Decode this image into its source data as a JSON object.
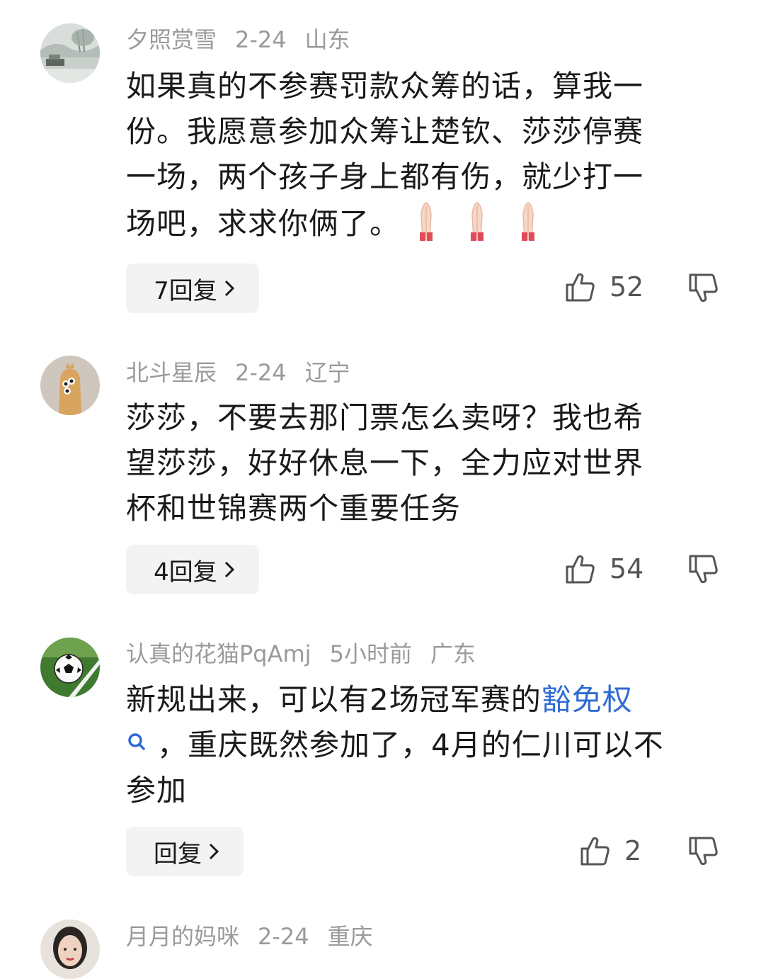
{
  "comments": [
    {
      "user": "夕照赏雪",
      "time": "2-24",
      "location": "山东",
      "lines": [
        "如果真的不参赛罚款众筹的话，算我一",
        "份。我愿意参加众筹让楚钦、莎莎停赛",
        "一场，两个孩子身上都有伤，就少打一",
        "场吧，求求你俩了。"
      ],
      "emoji": "folded-hands",
      "reply_label": "7回复",
      "likes": "52",
      "avatar_icon": "landscape-avatar"
    },
    {
      "user": "北斗星辰",
      "time": "2-24",
      "location": "辽宁",
      "lines": [
        "莎莎，不要去那门票怎么卖呀？我也希",
        "望莎莎，好好休息一下，全力应对世界",
        "杯和世锦赛两个重要任务"
      ],
      "reply_label": "4回复",
      "likes": "54",
      "avatar_icon": "cartoon-avatar"
    },
    {
      "user": "认真的花猫PqAmj",
      "time": "5小时前",
      "location": "广东",
      "line1_prefix": "新规出来，可以有2场冠军赛的",
      "line1_keyword": "豁免权",
      "line2": "，重庆既然参加了，4月的仁川可以不",
      "line3": "参加",
      "reply_label": "回复",
      "likes": "2",
      "avatar_icon": "soccer-ball-avatar"
    },
    {
      "user": "月月的妈咪",
      "time": "2-24",
      "location": "重庆",
      "avatar_icon": "portrait-avatar"
    }
  ],
  "colors": {
    "keyword": "#2f6bd3",
    "meta": "#9a9a9a",
    "reply_bg": "#f3f3f3"
  }
}
